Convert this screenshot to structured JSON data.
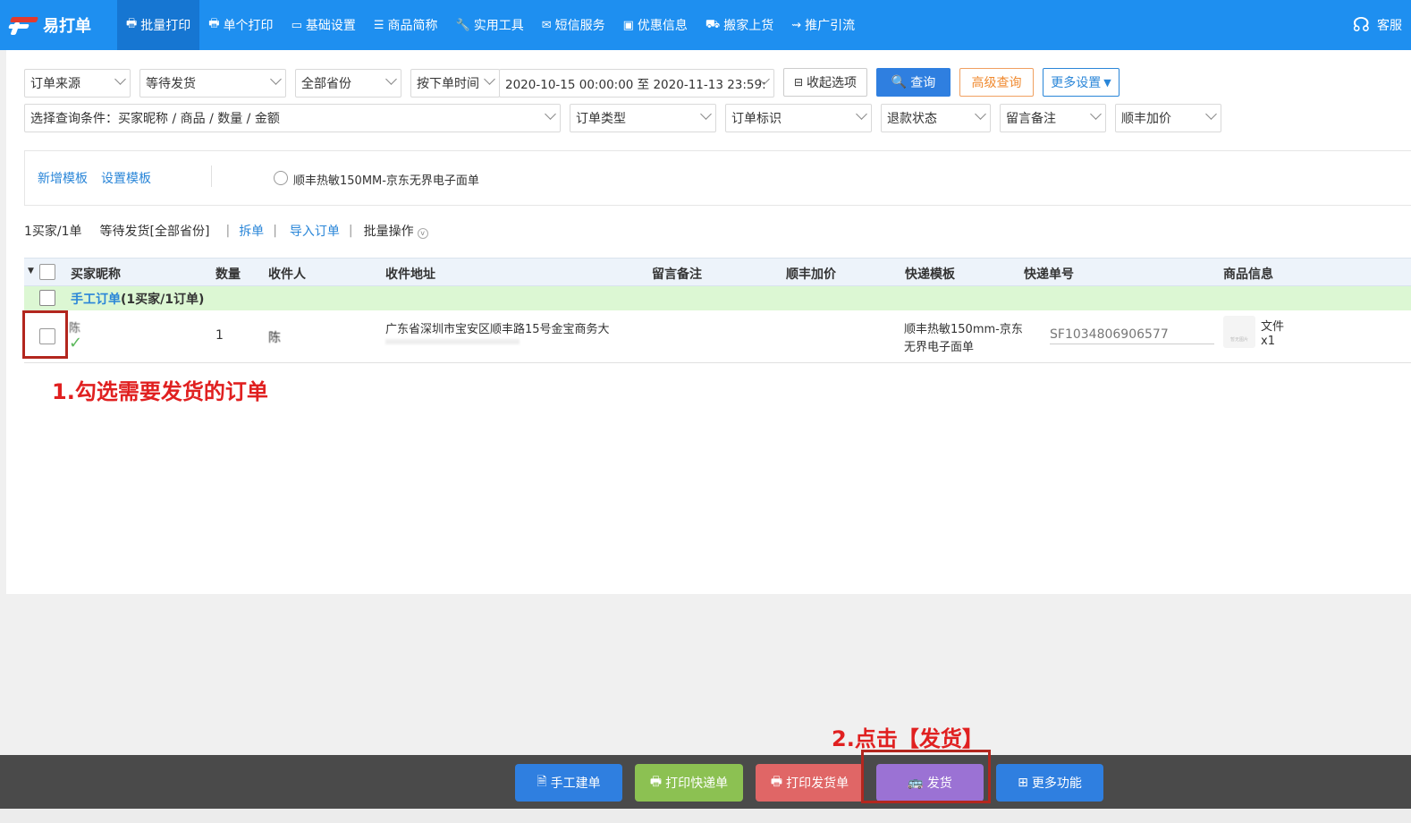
{
  "app": {
    "name": "易打单",
    "service_label": "客服"
  },
  "nav": [
    {
      "label": "批量打印",
      "icon": "printer-icon",
      "active": true
    },
    {
      "label": "单个打印",
      "icon": "printer-icon",
      "active": false
    },
    {
      "label": "基础设置",
      "icon": "monitor-icon",
      "active": false
    },
    {
      "label": "商品简称",
      "icon": "list-icon",
      "active": false
    },
    {
      "label": "实用工具",
      "icon": "wrench-icon",
      "active": false
    },
    {
      "label": "短信服务",
      "icon": "envelope-icon",
      "active": false
    },
    {
      "label": "优惠信息",
      "icon": "money-icon",
      "active": false
    },
    {
      "label": "搬家上货",
      "icon": "bag-icon",
      "active": false
    },
    {
      "label": "推广引流",
      "icon": "car-icon",
      "active": false
    }
  ],
  "filters": {
    "order_source": "订单来源",
    "status": "等待发货",
    "province": "全部省份",
    "time_type": "按下单时间",
    "date_range": "2020-10-15 00:00:00 至 2020-11-13 23:59:",
    "collapse_label": "收起选项",
    "query_label": "查询",
    "advanced_query_label": "高级查询",
    "more_settings_label": "更多设置",
    "condition": "选择查询条件：买家昵称 / 商品 / 数量 / 金额",
    "order_type": "订单类型",
    "order_flag": "订单标识",
    "refund_status": "退款状态",
    "remark": "留言备注",
    "sf_price": "顺丰加价"
  },
  "templates": {
    "add_label": "新增模板",
    "settings_label": "设置模板",
    "option_label": "顺丰热敏150MM-京东无界电子面单"
  },
  "stats": {
    "summary": "1买家/1单",
    "status_text": "等待发货[全部省份]",
    "split_label": "拆单",
    "import_label": "导入订单",
    "batch_label": "批量操作"
  },
  "table": {
    "headers": {
      "buyer": "买家昵称",
      "qty": "数量",
      "receiver": "收件人",
      "address": "收件地址",
      "remark": "留言备注",
      "sf_price": "顺丰加价",
      "template": "快递模板",
      "tracking": "快递单号",
      "goods": "商品信息"
    },
    "group": {
      "link": "手工订单",
      "count": "(1买家/1订单)"
    },
    "rows": [
      {
        "buyer": "陈",
        "qty": "1",
        "receiver": "陈",
        "address": "广东省深圳市宝安区顺丰路15号金宝商务大",
        "template_line1": "顺丰热敏150mm-京东",
        "template_line2": "无界电子面单",
        "tracking": "SF1034806906577",
        "goods_name": "文件",
        "goods_qty": "x1",
        "goods_thumb_text": "暂无图片"
      }
    ]
  },
  "annotations": {
    "step1": "1.勾选需要发货的订单",
    "step2": "2.点击【发货】"
  },
  "bottom": {
    "manual_label": "手工建单",
    "print_express_label": "打印快递单",
    "print_delivery_label": "打印发货单",
    "ship_label": "发货",
    "more_label": "更多功能"
  },
  "colors": {
    "nav_bg": "#1e8ff0",
    "nav_active": "#1676d2",
    "accent_red": "#e02020",
    "btn_blue": "#2f7fe0",
    "btn_green": "#8cc152",
    "btn_red": "#e06666",
    "btn_purple": "#9b72d4",
    "group_green": "#dcf7d3"
  }
}
